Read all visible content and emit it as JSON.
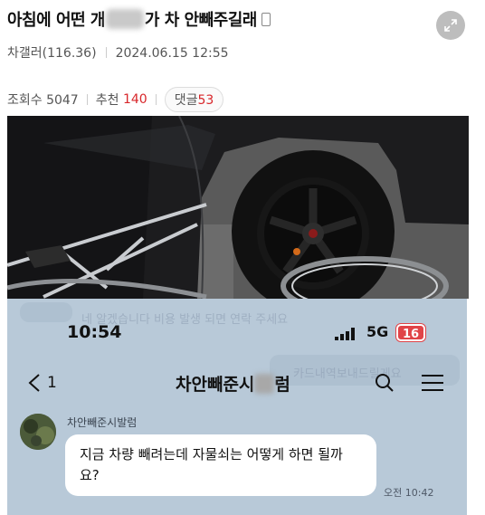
{
  "post": {
    "title_before": "아침에 어떤 개",
    "title_after": "가 차 안빼주길래",
    "author": "차갤러(116.36)",
    "datetime": "2024.06.15 12:55",
    "views_label": "조회수 5047",
    "likes_label": "추천",
    "likes_value": "140",
    "comments_label": "댓글",
    "comments_value": "53"
  },
  "icons": {
    "phone": "mobile-phone-icon",
    "share": "expand-arrows-icon"
  },
  "chat": {
    "ghost_line_1": "네 알겠습니다 비용 발생 되면 연락 주세요",
    "ghost_line_2": "카드내역보내드릴게요",
    "status_time": "10:54",
    "network": "5G",
    "battery": "16",
    "back_count": "1",
    "room_title_before": "차안빼준시",
    "room_title_after": "럼",
    "sender_name": "차안빼준시발럼",
    "message": "지금 차량 빼려는데 자물쇠는 어떻게 하면 될까요?",
    "message_time": "오전 10:42"
  },
  "colors": {
    "accent_red": "#d8262a",
    "chat_bg": "#b8c9d8",
    "battery_red": "#e04448"
  }
}
